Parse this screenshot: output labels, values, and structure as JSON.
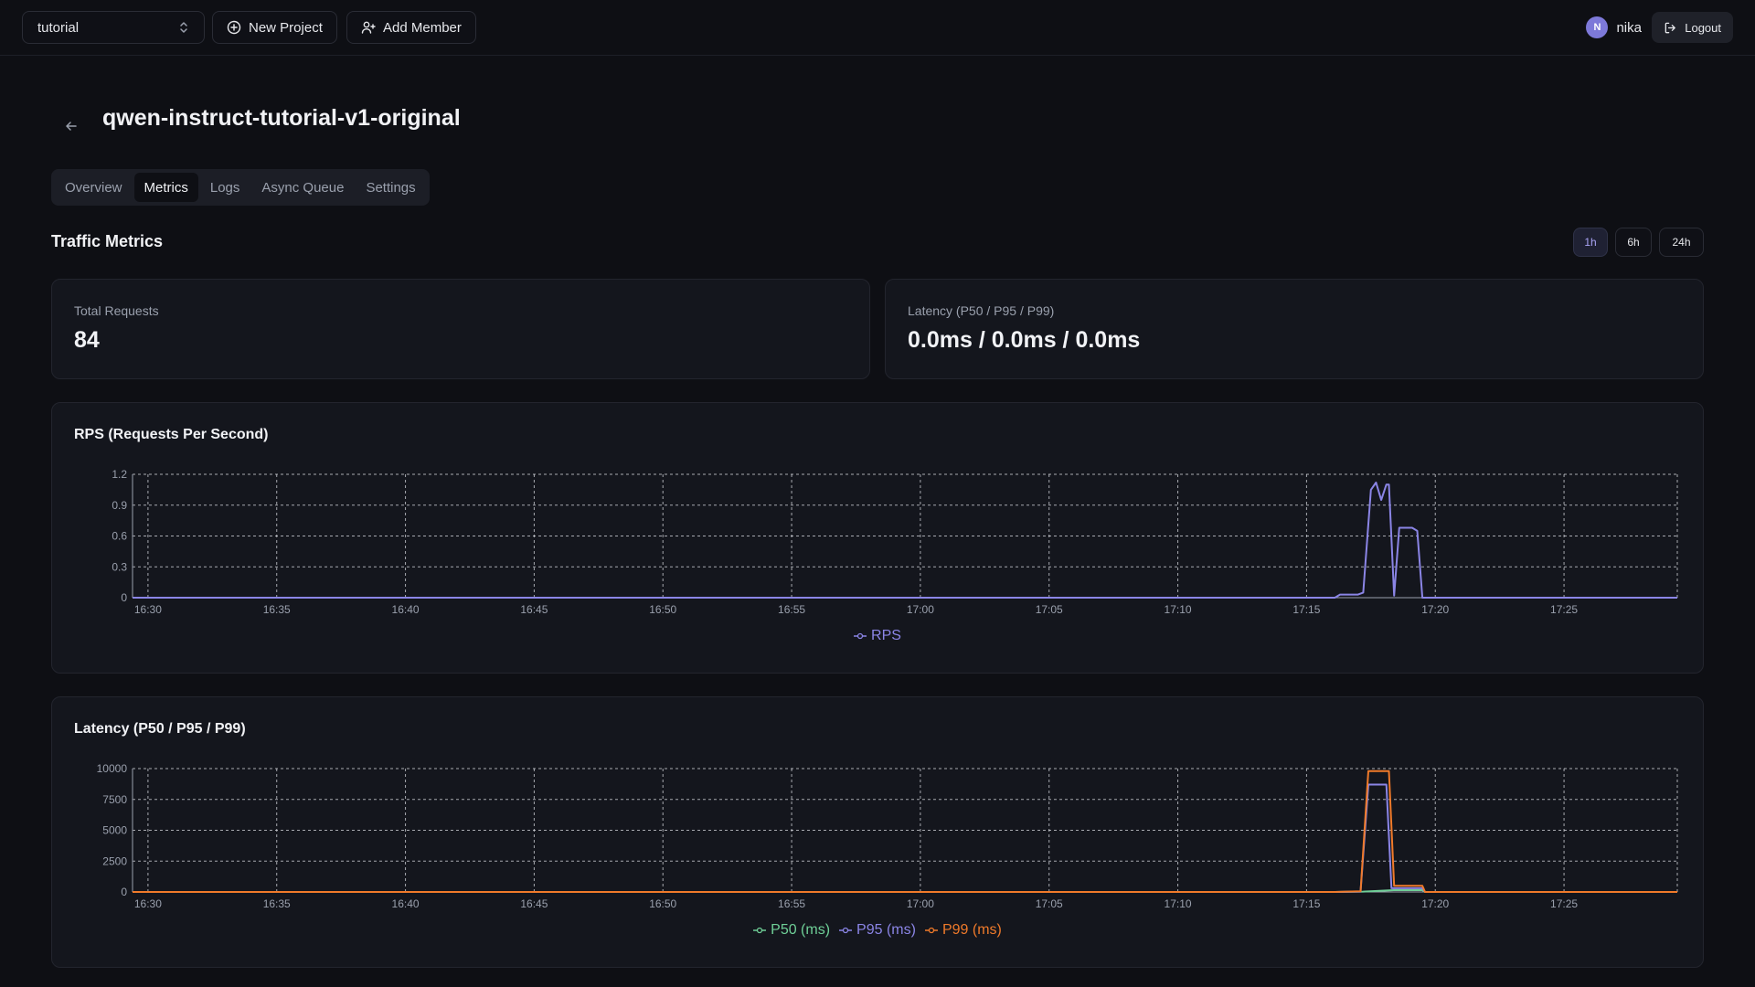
{
  "topbar": {
    "project_select": {
      "value": "tutorial",
      "icon": "chevron-updown-icon"
    },
    "new_project_label": "New Project",
    "add_member_label": "Add Member",
    "user": {
      "initial": "N",
      "name": "nika"
    },
    "logout_label": "Logout"
  },
  "page": {
    "title": "qwen-instruct-tutorial-v1-original",
    "tabs": [
      {
        "label": "Overview"
      },
      {
        "label": "Metrics",
        "active": true
      },
      {
        "label": "Logs"
      },
      {
        "label": "Async Queue"
      },
      {
        "label": "Settings"
      }
    ]
  },
  "traffic": {
    "title": "Traffic Metrics",
    "ranges": [
      {
        "label": "1h",
        "active": true
      },
      {
        "label": "6h"
      },
      {
        "label": "24h"
      }
    ]
  },
  "stats": {
    "total_requests": {
      "label": "Total Requests",
      "value": "84"
    },
    "latency": {
      "label": "Latency (P50 / P95 / P99)",
      "value": "0.0ms / 0.0ms / 0.0ms"
    }
  },
  "colors": {
    "rps": "#8b85e6",
    "p50": "#6fcf97",
    "p95": "#8b85e6",
    "p99": "#f07a2a",
    "grid": "#d8dae0",
    "axis": "#9aa0ad"
  },
  "chart_data": [
    {
      "type": "line",
      "title": "RPS (Requests Per Second)",
      "x_ticks": [
        "16:30",
        "16:35",
        "16:40",
        "16:45",
        "16:50",
        "16:55",
        "17:00",
        "17:05",
        "17:10",
        "17:15",
        "17:20",
        "17:25"
      ],
      "xlim": [
        "16:29.4",
        "17:29.4"
      ],
      "ylim": [
        0,
        1.2
      ],
      "y_ticks": [
        "0",
        "0.3",
        "0.6",
        "0.9",
        "1.2"
      ],
      "grid": true,
      "legend": "bottom-center",
      "series": [
        {
          "name": "RPS",
          "color": "#8b85e6",
          "points": [
            [
              "16:29.4",
              0
            ],
            [
              "17:16.1",
              0
            ],
            [
              "17:16.3",
              0.03
            ],
            [
              "17:17.0",
              0.03
            ],
            [
              "17:17.2",
              0.05
            ],
            [
              "17:17.5",
              1.05
            ],
            [
              "17:17.7",
              1.12
            ],
            [
              "17:17.9",
              0.95
            ],
            [
              "17:18.1",
              1.1
            ],
            [
              "17:18.2",
              1.1
            ],
            [
              "17:18.4",
              0.02
            ],
            [
              "17:18.6",
              0.68
            ],
            [
              "17:19.1",
              0.68
            ],
            [
              "17:19.3",
              0.65
            ],
            [
              "17:19.5",
              0
            ],
            [
              "17:29.4",
              0
            ]
          ]
        }
      ]
    },
    {
      "type": "line",
      "title": "Latency (P50 / P95 / P99)",
      "x_ticks": [
        "16:30",
        "16:35",
        "16:40",
        "16:45",
        "16:50",
        "16:55",
        "17:00",
        "17:05",
        "17:10",
        "17:15",
        "17:20",
        "17:25"
      ],
      "xlim": [
        "16:29.4",
        "17:29.4"
      ],
      "ylim": [
        0,
        10000
      ],
      "y_ticks": [
        "0",
        "2500",
        "5000",
        "7500",
        "10000"
      ],
      "grid": true,
      "legend": "bottom-center",
      "series": [
        {
          "name": "P50 (ms)",
          "color": "#6fcf97",
          "points": [
            [
              "16:29.4",
              0
            ],
            [
              "17:16.1",
              0
            ],
            [
              "17:17.2",
              30
            ],
            [
              "17:18.4",
              150
            ],
            [
              "17:19.5",
              150
            ],
            [
              "17:19.6",
              0
            ],
            [
              "17:29.4",
              0
            ]
          ]
        },
        {
          "name": "P95 (ms)",
          "color": "#8b85e6",
          "points": [
            [
              "16:29.4",
              0
            ],
            [
              "17:16.1",
              0
            ],
            [
              "17:17.1",
              30
            ],
            [
              "17:17.4",
              8700
            ],
            [
              "17:18.1",
              8700
            ],
            [
              "17:18.3",
              300
            ],
            [
              "17:19.5",
              300
            ],
            [
              "17:19.6",
              0
            ],
            [
              "17:29.4",
              0
            ]
          ]
        },
        {
          "name": "P99 (ms)",
          "color": "#f07a2a",
          "points": [
            [
              "16:29.4",
              0
            ],
            [
              "17:16.1",
              0
            ],
            [
              "17:17.1",
              50
            ],
            [
              "17:17.4",
              9800
            ],
            [
              "17:18.2",
              9800
            ],
            [
              "17:18.4",
              500
            ],
            [
              "17:19.5",
              500
            ],
            [
              "17:19.6",
              0
            ],
            [
              "17:29.4",
              0
            ]
          ]
        }
      ]
    }
  ]
}
